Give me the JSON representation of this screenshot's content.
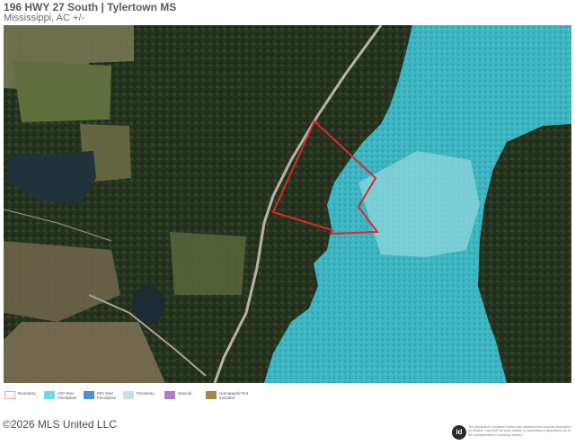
{
  "header": {
    "title": "196 HWY 27 South | Tylertown MS",
    "subtitle": "Mississippi,  AC +/-"
  },
  "map": {
    "scale_labels": [
      "0",
      "500",
      "1000",
      "1500",
      "2000ft"
    ],
    "colors": {
      "forest": "#2b3a23",
      "field": "#6b7a4c",
      "floodzone": "#46c6d4",
      "boundary": "#e0262a"
    }
  },
  "legend": {
    "items": [
      {
        "label": "Boundary",
        "color": "#f0a0a0"
      },
      {
        "label": "100 Year Floodplain",
        "color": "#6fd8e0"
      },
      {
        "label": "500 Year Floodplain",
        "color": "#4d8fd8"
      },
      {
        "label": "Floodway",
        "color": "#bfe3e6"
      },
      {
        "label": "Special",
        "color": "#b17cc8"
      },
      {
        "label": "Unmapped/ Not Included",
        "color": "#9e8a4a"
      }
    ]
  },
  "footer": {
    "copyright": "©2026 MLS United LLC",
    "logo_text": "id",
    "disclaimer": "The information contained herein was obtained from sources deemed to be reliable. Land id® Services makes no warranties or guarantees as to the completeness or accuracy thereof."
  }
}
